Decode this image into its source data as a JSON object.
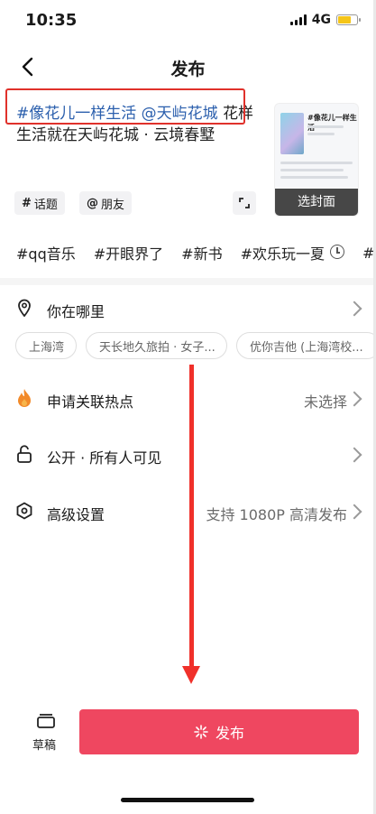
{
  "status_bar": {
    "time": "10:35",
    "network": "4G"
  },
  "header": {
    "title": "发布"
  },
  "caption": {
    "tag1": "#像花儿一样生活",
    "mention": "@天屿花城",
    "text": "花样生活就在天屿花城 · 云境春墅"
  },
  "cover": {
    "preview_title": "#像花儿一样生活",
    "select_label": "选封面"
  },
  "chips": {
    "topic": "话题",
    "topic_symbol": "#",
    "friend": "朋友",
    "friend_symbol": "@"
  },
  "hashtags": [
    "#qq音乐",
    "#开眼界了",
    "#新书",
    "#欢乐玩一夏",
    "#a"
  ],
  "location": {
    "label": "你在哪里",
    "suggestions": [
      "上海湾",
      "天长地久旅拍 · 女子...",
      "优你吉他 (上海湾校..."
    ]
  },
  "hotspot": {
    "label": "申请关联热点",
    "value": "未选择"
  },
  "visibility": {
    "label": "公开 · 所有人可见"
  },
  "advanced": {
    "label": "高级设置",
    "value": "支持 1080P 高清发布"
  },
  "bottom": {
    "draft_label": "草稿",
    "publish_label": "发布"
  },
  "colors": {
    "accent": "#ef4760",
    "tag": "#2b5fad",
    "annotation": "#e0312b"
  }
}
